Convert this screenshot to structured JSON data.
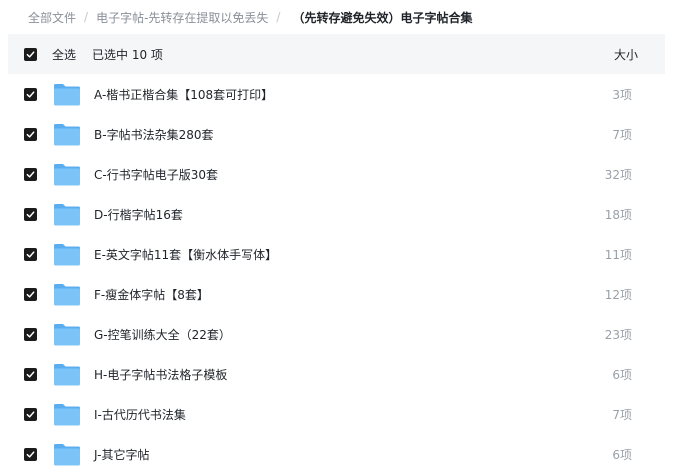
{
  "breadcrumb": {
    "root": "全部文件",
    "parent": "电子字帖-先转存在提取以免丢失",
    "current": "（先转存避免失效）电子字帖合集"
  },
  "header": {
    "select_all": "全选",
    "selected_count": "已选中  10  项",
    "size_label": "大小"
  },
  "files": [
    {
      "name": "A-楷书正楷合集【108套可打印】",
      "count": "3项"
    },
    {
      "name": "B-字帖书法杂集280套",
      "count": "7项"
    },
    {
      "name": "C-行书字帖电子版30套",
      "count": "32项"
    },
    {
      "name": "D-行楷字帖16套",
      "count": "18项"
    },
    {
      "name": "E-英文字帖11套【衡水体手写体】",
      "count": "11项"
    },
    {
      "name": "F-瘦金体字帖【8套】",
      "count": "12项"
    },
    {
      "name": "G-控笔训练大全（22套）",
      "count": "23项"
    },
    {
      "name": "H-电子字帖书法格子模板",
      "count": "6项"
    },
    {
      "name": "I-古代历代书法集",
      "count": "7项"
    },
    {
      "name": "J-其它字帖",
      "count": "6项"
    }
  ],
  "colors": {
    "checkbox": "#1b1b1b",
    "folder_body": "#7cc4f8",
    "folder_tab": "#5aaef0",
    "header_bg": "#f5f6f8"
  },
  "icons": {
    "checkbox": "check-icon",
    "folder": "folder-icon"
  }
}
